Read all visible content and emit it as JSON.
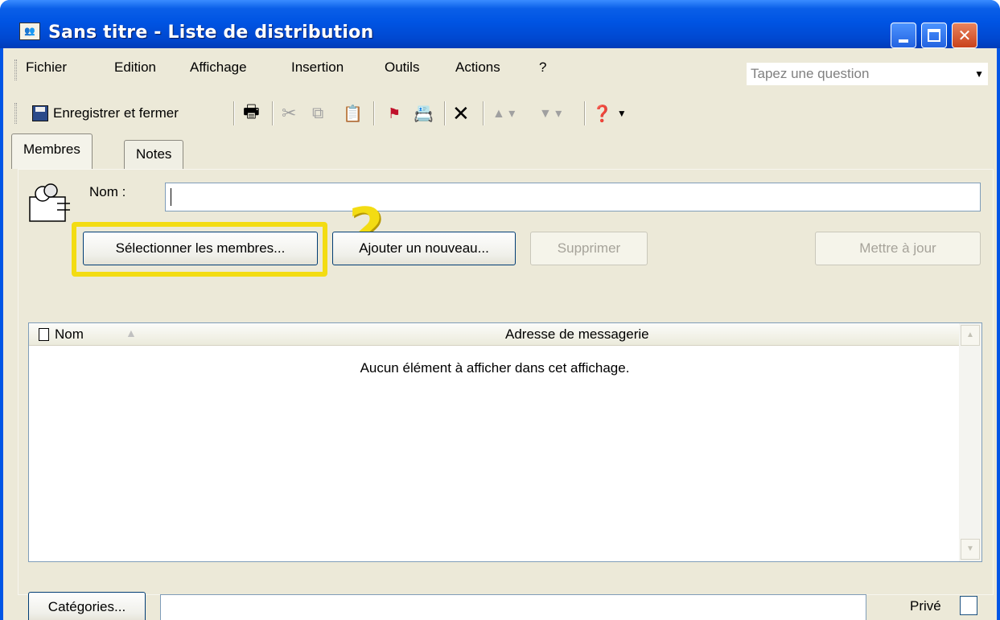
{
  "window": {
    "title": "Sans titre - Liste de distribution",
    "title_icon": "distribution-list-icon"
  },
  "menu": {
    "items": [
      "Fichier",
      "Edition",
      "Affichage",
      "Insertion",
      "Outils",
      "Actions",
      "?"
    ],
    "ask_placeholder": "Tapez une question"
  },
  "toolbar": {
    "save_label": "Enregistrer et fermer",
    "icons": [
      "save-icon",
      "print-icon",
      "cut-icon",
      "copy-icon",
      "paste-icon",
      "flag-icon",
      "address-book-icon",
      "delete-icon",
      "previous-item-icon",
      "next-item-icon",
      "help-icon"
    ]
  },
  "tabs": {
    "members": "Membres",
    "notes": "Notes"
  },
  "form": {
    "name_label": "Nom :",
    "name_value": "",
    "annotation_number": "2"
  },
  "buttons": {
    "select_members": "Sélectionner les membres...",
    "add_new": "Ajouter un nouveau...",
    "delete": "Supprimer",
    "update": "Mettre à jour",
    "categories": "Catégories..."
  },
  "list": {
    "columns": [
      "Nom",
      "Adresse de messagerie"
    ],
    "empty_message": "Aucun élément à afficher dans cet affichage."
  },
  "footer": {
    "categories_value": "",
    "private_label": "Privé",
    "private_checked": false
  },
  "colors": {
    "titlebar": "#0054e3",
    "window_bg": "#ece9d8",
    "highlight": "#f3dc13"
  }
}
